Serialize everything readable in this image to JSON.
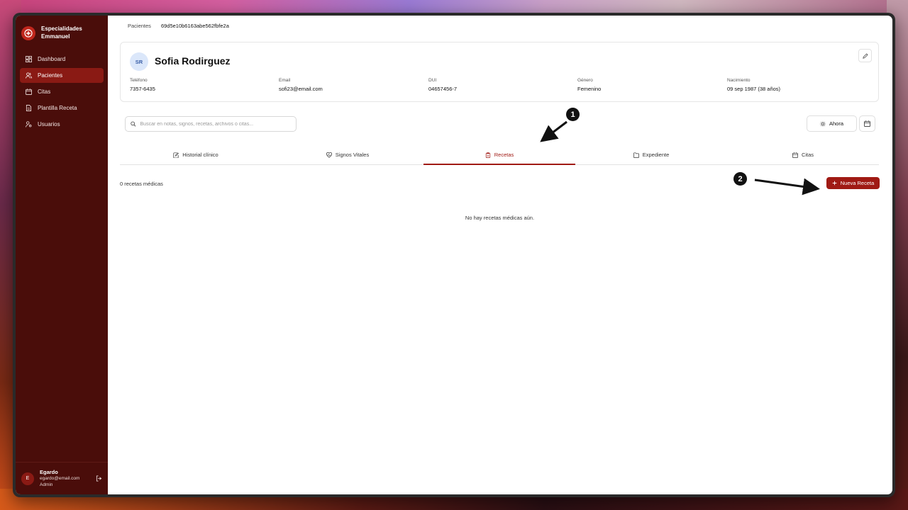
{
  "sidebar": {
    "brand": "Especialidades Emmanuel",
    "items": [
      {
        "label": "Dashboard",
        "icon": "dashboard-icon",
        "active": false
      },
      {
        "label": "Pacientes",
        "icon": "users-icon",
        "active": true
      },
      {
        "label": "Citas",
        "icon": "calendar-icon",
        "active": false
      },
      {
        "label": "Plantilla Receta",
        "icon": "document-icon",
        "active": false
      },
      {
        "label": "Usuarios",
        "icon": "user-cog-icon",
        "active": false
      }
    ],
    "user": {
      "initial": "E",
      "name": "Egardo",
      "email": "egardo@email.com",
      "role": "Admin"
    }
  },
  "breadcrumb": {
    "parent": "Pacientes",
    "current": "69d5e10b6163abe562fbfe2a"
  },
  "patient": {
    "initials": "SR",
    "name": "Sofia Rodirguez",
    "fields": [
      {
        "label": "Teléfono",
        "value": "7357-6435"
      },
      {
        "label": "Email",
        "value": "sofi23@email.com"
      },
      {
        "label": "DUI",
        "value": "04657456-7"
      },
      {
        "label": "Género",
        "value": "Femenino"
      },
      {
        "label": "Nacimiento",
        "value": "09 sep 1987 (38 años)"
      }
    ]
  },
  "search": {
    "placeholder": "Buscar en notas, signos, recetas, archivos o citas...",
    "value": ""
  },
  "now_button": "Ahora",
  "tabs": [
    {
      "label": "Historial clínico",
      "icon": "clipboard-edit-icon",
      "active": false
    },
    {
      "label": "Signos Vitales",
      "icon": "heart-pulse-icon",
      "active": false
    },
    {
      "label": "Recetas",
      "icon": "clipboard-icon",
      "active": true
    },
    {
      "label": "Expediente",
      "icon": "folder-icon",
      "active": false
    },
    {
      "label": "Citas",
      "icon": "calendar-icon",
      "active": false
    }
  ],
  "recetas": {
    "count_label": "0 recetas médicas",
    "new_button": "Nueva Receta",
    "empty_message": "No hay recetas médicas aún."
  },
  "annotations": [
    {
      "number": "1"
    },
    {
      "number": "2"
    }
  ],
  "colors": {
    "sidebar": "#4a0d0a",
    "accent": "#a01a14",
    "active_nav": "#8a1a14"
  }
}
